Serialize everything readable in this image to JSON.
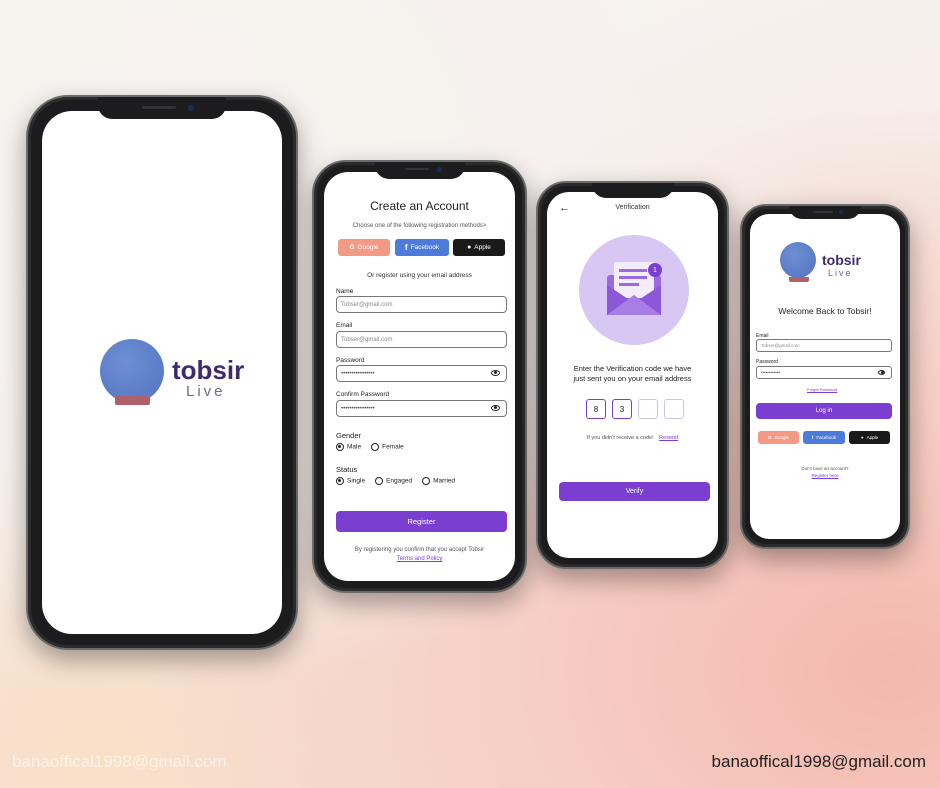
{
  "splash": {
    "brand": "tobsir",
    "brand_sub": "Live"
  },
  "register": {
    "title": "Create an Account",
    "subtitle": "Choose one of the following registration methods>",
    "google": "Google",
    "facebook": "Facebook",
    "apple": "Apple",
    "or_email": "Or register using your email address",
    "name_label": "Name",
    "name_placeholder": "Tobser@gmail.com",
    "email_label": "Email",
    "email_placeholder": "Tobser@gmail.com",
    "password_label": "Password",
    "password_value": "••••••••••••••••",
    "confirm_label": "Confirm Password",
    "confirm_value": "••••••••••••••••",
    "gender_label": "Gender",
    "gender_options": [
      "Male",
      "Female"
    ],
    "status_label": "Status",
    "status_options": [
      "Single",
      "Engaged",
      "Married"
    ],
    "register_button": "Register",
    "footer_text": "By registering you confirm that you accept Tobsir",
    "terms_link": "Terms and Policy"
  },
  "verify": {
    "title": "Verification",
    "badge": "1",
    "heading_line1": "Enter the Verification code we have",
    "heading_line2": "just sent you on your email address",
    "digits": [
      "8",
      "3",
      "",
      ""
    ],
    "resend_prompt": "If you didn't receive a code!",
    "resend_link": "Resend",
    "verify_button": "Verify"
  },
  "login": {
    "brand": "tobsir",
    "brand_sub": "Live",
    "welcome": "Welcome Back to Tobsir!",
    "email_label": "Email",
    "email_placeholder": "Tobser@gmail.com",
    "password_label": "Password",
    "password_value": "••••••••••••",
    "forgot": "Forget Password",
    "login_button": "Log in",
    "google": "Google",
    "facebook": "Facebook",
    "apple": "Apple",
    "no_account": "Don't have an account?",
    "register_link": "Register here"
  },
  "footer": {
    "email_left": "banaoffical1998@gmail.com",
    "email_right": "banaoffical1998@gmail.com"
  },
  "colors": {
    "accent": "#7a3fd1",
    "google": "#f29a86",
    "facebook": "#4c7bd9",
    "apple": "#1a1a1a"
  }
}
